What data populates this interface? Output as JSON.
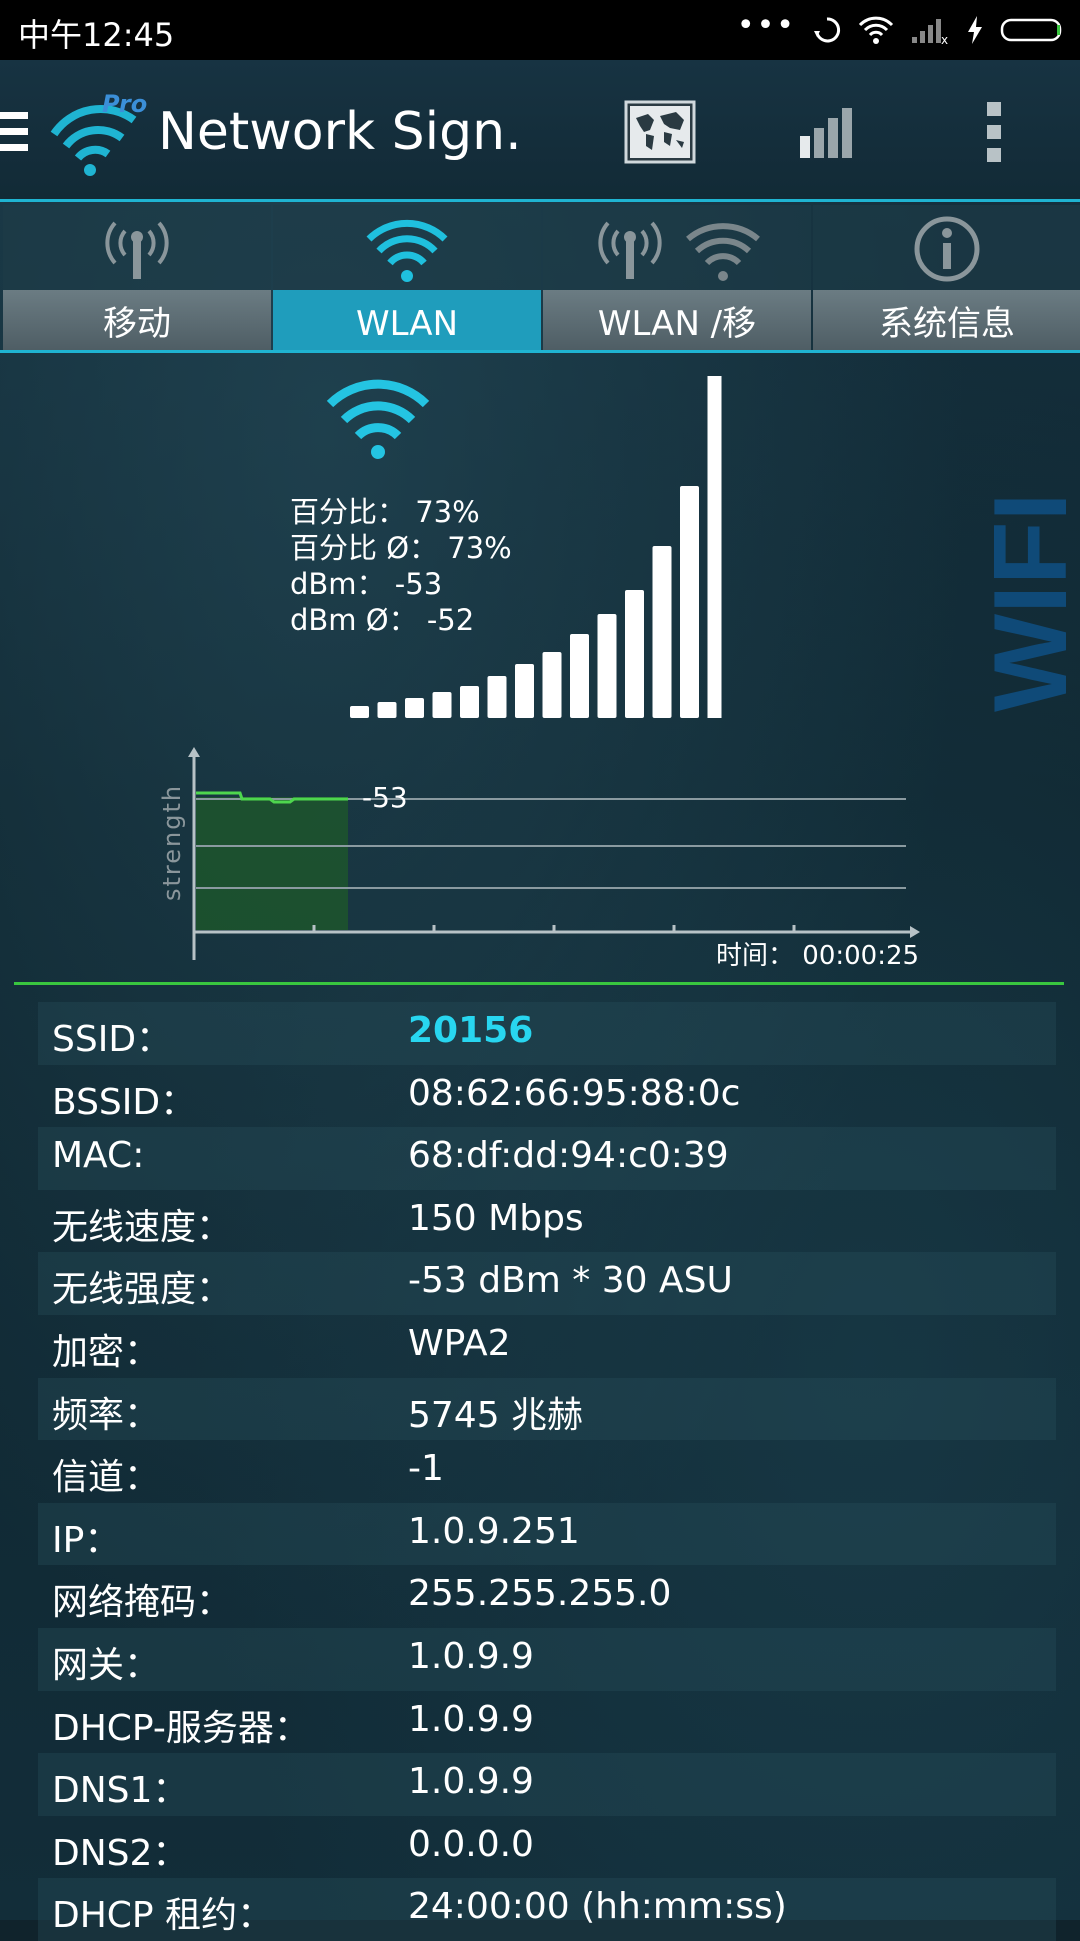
{
  "status_bar": {
    "time": "中午12:45",
    "more": "•••",
    "icons": [
      "sync-icon",
      "wifi-icon",
      "cell-signal-icon",
      "charging-icon",
      "battery-icon"
    ]
  },
  "app_bar": {
    "title": "Network Sign.",
    "logo_badge": "Pro",
    "actions": [
      "menu-icon",
      "world-map-icon",
      "signal-bars-icon",
      "overflow-menu-icon"
    ]
  },
  "tabs": [
    {
      "label": "移动",
      "icon": "cell-tower-icon",
      "active": false
    },
    {
      "label": "WLAN",
      "icon": "wifi-icon",
      "active": true
    },
    {
      "label": "WLAN /移",
      "icon": "tower-and-wifi-icon",
      "active": false
    },
    {
      "label": "系统信息",
      "icon": "info-icon",
      "active": false
    }
  ],
  "signal": {
    "percent_label": "百分比：",
    "percent_value": "73%",
    "percent_avg_label": "百分比 Ø：",
    "percent_avg_value": "73%",
    "dbm_label": "dBm：",
    "dbm_value": "-53",
    "dbm_avg_label": "dBm Ø：",
    "dbm_avg_value": "-52",
    "bar_count_lit": 13,
    "watermark": "WIFI"
  },
  "graph": {
    "axis_label": "strength",
    "current_value": "-53",
    "time_label": "时间：",
    "time_value": "00:00:25"
  },
  "info": [
    {
      "key": "SSID：",
      "value": "20156",
      "accent": true
    },
    {
      "key": "BSSID：",
      "value": "08:62:66:95:88:0c"
    },
    {
      "key": "MAC:",
      "value": "68:df:dd:94:c0:39"
    },
    {
      "key": "无线速度：",
      "value": "150 Mbps"
    },
    {
      "key": "无线强度：",
      "value": "-53 dBm * 30 ASU"
    },
    {
      "key": "加密：",
      "value": "WPA2"
    },
    {
      "key": "频率：",
      "value": "5745 兆赫"
    },
    {
      "key": "信道：",
      "value": "-1"
    },
    {
      "key": "IP：",
      "value": "1.0.9.251"
    },
    {
      "key": "网络掩码：",
      "value": "255.255.255.0"
    },
    {
      "key": "网关：",
      "value": "1.0.9.9"
    },
    {
      "key": "DHCP-服务器：",
      "value": "1.0.9.9"
    },
    {
      "key": "DNS1：",
      "value": "1.0.9.9"
    },
    {
      "key": "DNS2：",
      "value": "0.0.0.0"
    },
    {
      "key": "DHCP 租约：",
      "value": "24:00:00 (hh:mm:ss)"
    }
  ],
  "colors": {
    "accent": "#1fb4d2",
    "ssid": "#28d6f0",
    "graph_green": "#39c63f",
    "watermark_blue": "#0f4a78"
  }
}
